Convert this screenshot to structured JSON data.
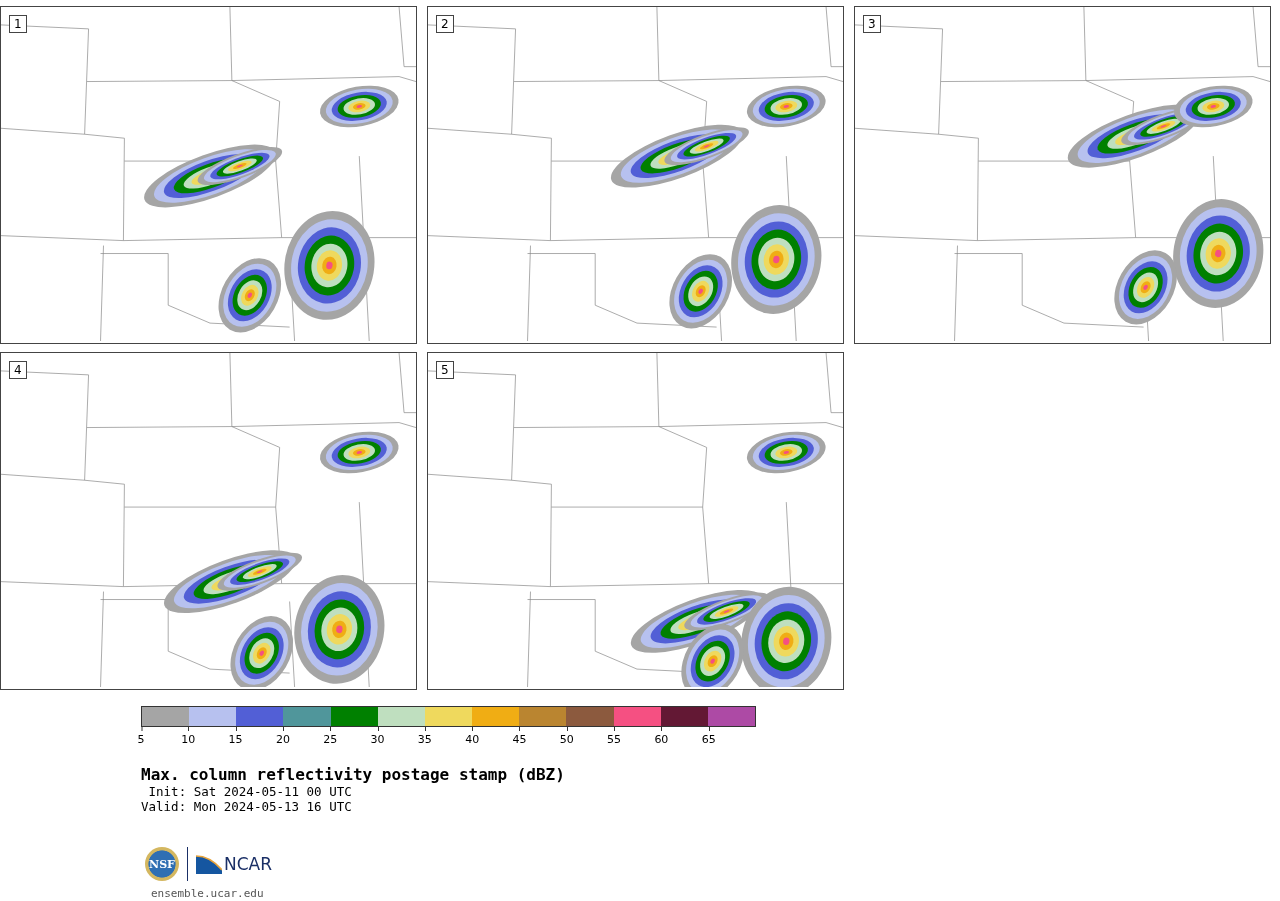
{
  "panels": [
    {
      "label": "1"
    },
    {
      "label": "2"
    },
    {
      "label": "3"
    },
    {
      "label": "4"
    },
    {
      "label": "5"
    }
  ],
  "colorbar": {
    "bins": [
      {
        "color": "#a5a5a5"
      },
      {
        "color": "#b7c1ef"
      },
      {
        "color": "#525fd6"
      },
      {
        "color": "#50969b"
      },
      {
        "color": "#008000"
      },
      {
        "color": "#bfdfbf"
      },
      {
        "color": "#efd95d"
      },
      {
        "color": "#f0ad14"
      },
      {
        "color": "#ba8530"
      },
      {
        "color": "#8c5a3e"
      },
      {
        "color": "#f55082"
      },
      {
        "color": "#631834"
      },
      {
        "color": "#ad4aa5"
      }
    ],
    "ticks": [
      "5",
      "10",
      "15",
      "20",
      "25",
      "30",
      "35",
      "40",
      "45",
      "50",
      "55",
      "60",
      "65"
    ]
  },
  "title": "Max. column reflectivity postage stamp (dBZ)",
  "init": " Init: Sat 2024-05-11 00 UTC",
  "valid": "Valid: Mon 2024-05-13 16 UTC",
  "logos": {
    "nsf": "NSF",
    "ncar": "NCAR"
  },
  "url": "ensemble.ucar.edu"
}
